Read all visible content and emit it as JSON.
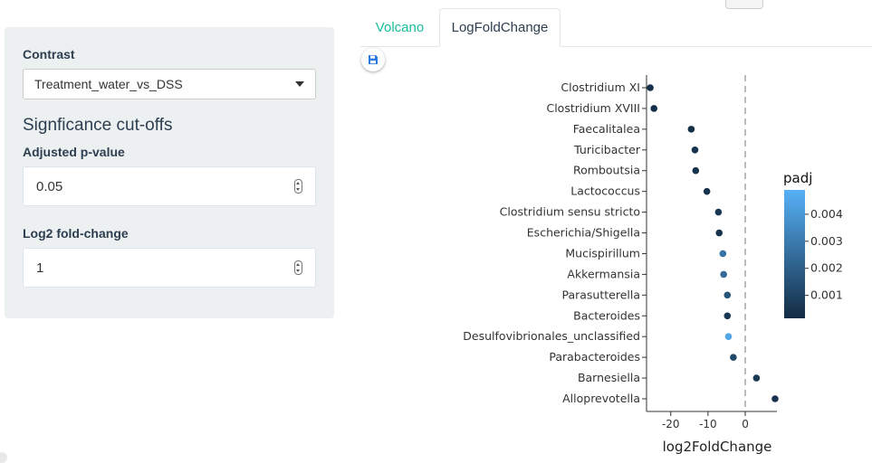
{
  "sidebar": {
    "contrast_label": "Contrast",
    "contrast_value": "Treatment_water_vs_DSS",
    "section_title": "Signficance cut-offs",
    "pvalue_label": "Adjusted p-value",
    "pvalue_value": "0.05",
    "lfc_label": "Log2 fold-change",
    "lfc_value": "1"
  },
  "tabs": [
    {
      "label": "Volcano",
      "active": false
    },
    {
      "label": "LogFoldChange",
      "active": true
    }
  ],
  "save_button": {
    "icon": "floppy-disk-icon"
  },
  "colors": {
    "accent": "#18bc9c",
    "heading": "#2c3e50",
    "sidebar_bg": "#ecf0f1"
  },
  "chart_data": {
    "type": "scatter",
    "xlabel": "log2FoldChange",
    "x_ticks": [
      -20,
      -10,
      0
    ],
    "xlim": [
      -26.5,
      8.5
    ],
    "reference_line_x": 0,
    "legend": {
      "title": "padj",
      "ticks": [
        0.004,
        0.003,
        0.002,
        0.001
      ],
      "range": [
        0.00015,
        0.0049
      ],
      "position": "right"
    },
    "points": [
      {
        "taxon": "Clostridium XI",
        "log2FoldChange": -25.5,
        "padj": 0.0003
      },
      {
        "taxon": "Clostridium XVIII",
        "log2FoldChange": -24.5,
        "padj": 0.0003
      },
      {
        "taxon": "Faecalitalea",
        "log2FoldChange": -14.5,
        "padj": 0.0003
      },
      {
        "taxon": "Turicibacter",
        "log2FoldChange": -13.5,
        "padj": 0.0004
      },
      {
        "taxon": "Romboutsia",
        "log2FoldChange": -13.3,
        "padj": 0.0004
      },
      {
        "taxon": "Lactococcus",
        "log2FoldChange": -10.3,
        "padj": 0.0004
      },
      {
        "taxon": "Clostridium sensu stricto",
        "log2FoldChange": -7.2,
        "padj": 0.0006
      },
      {
        "taxon": "Escherichia/Shigella",
        "log2FoldChange": -7.0,
        "padj": 0.0004
      },
      {
        "taxon": "Mucispirillum",
        "log2FoldChange": -6.0,
        "padj": 0.0027
      },
      {
        "taxon": "Akkermansia",
        "log2FoldChange": -5.8,
        "padj": 0.0024
      },
      {
        "taxon": "Parasutterella",
        "log2FoldChange": -4.8,
        "padj": 0.0016
      },
      {
        "taxon": "Bacteroides",
        "log2FoldChange": -4.8,
        "padj": 0.0006
      },
      {
        "taxon": "Desulfovibrionales_unclassified",
        "log2FoldChange": -4.5,
        "padj": 0.0045
      },
      {
        "taxon": "Parabacteroides",
        "log2FoldChange": -3.2,
        "padj": 0.0012
      },
      {
        "taxon": "Barnesiella",
        "log2FoldChange": 3.0,
        "padj": 0.0006
      },
      {
        "taxon": "Alloprevotella",
        "log2FoldChange": 8.0,
        "padj": 0.0004
      }
    ]
  }
}
